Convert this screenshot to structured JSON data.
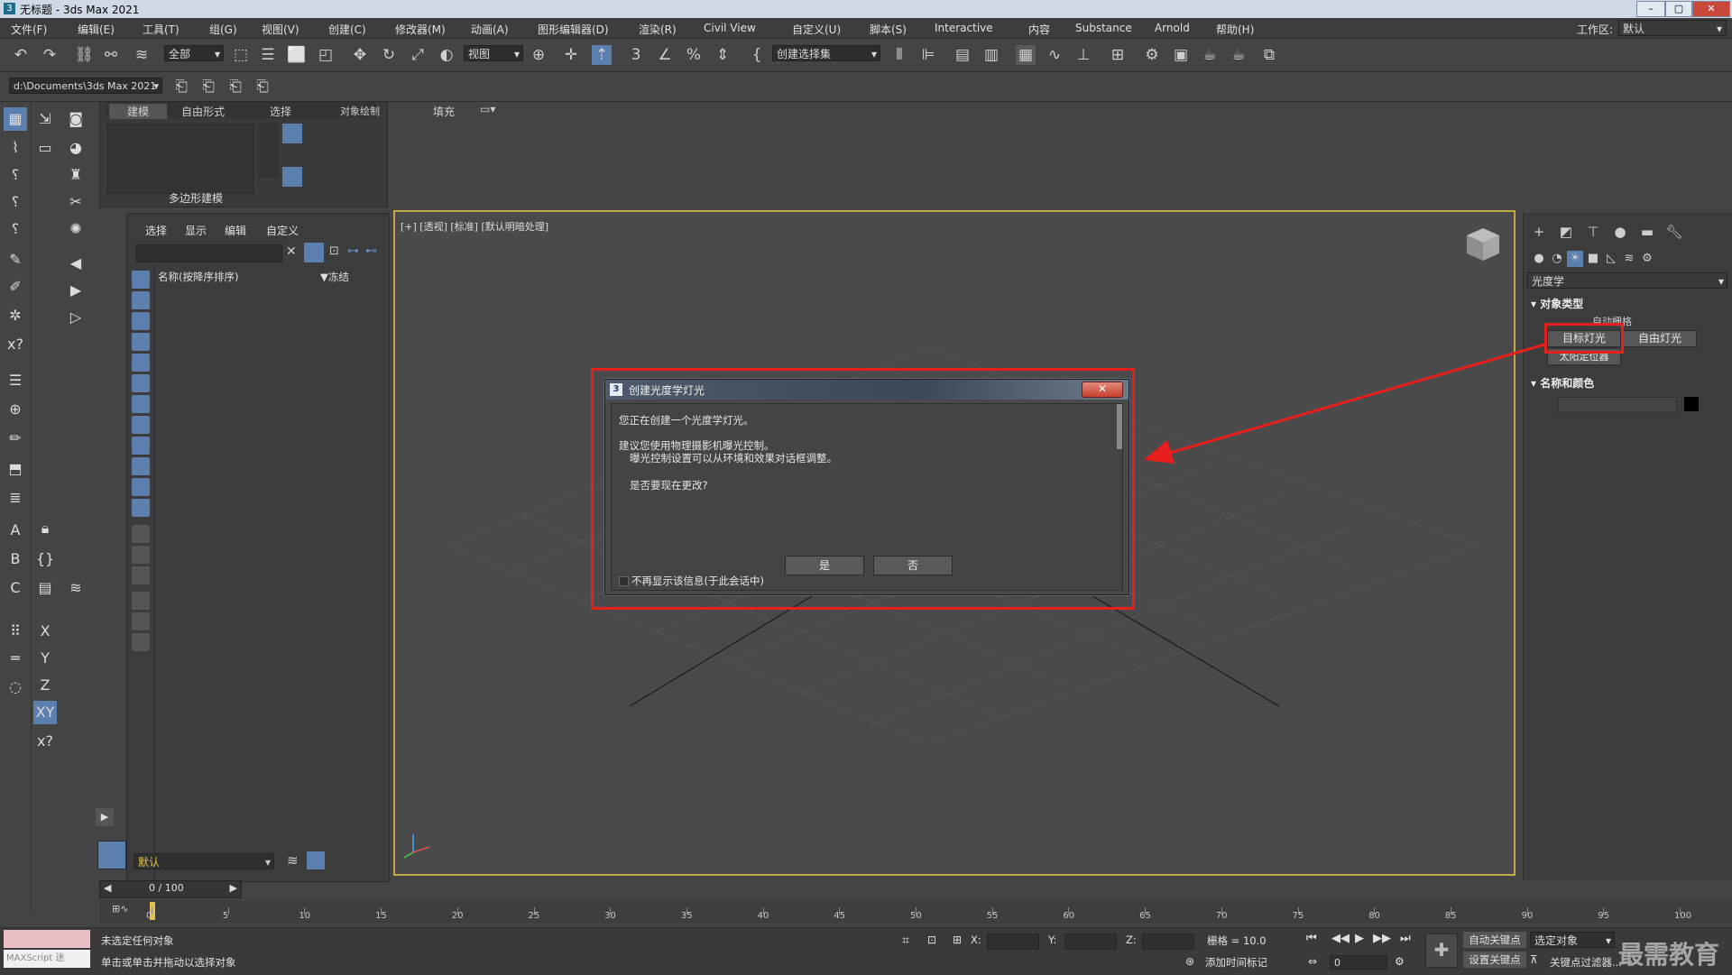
{
  "window": {
    "title": "无标题 - 3ds Max 2021",
    "logo": "3",
    "controls": [
      "–",
      "▢",
      "✕"
    ]
  },
  "menu": [
    "文件(F)",
    "编辑(E)",
    "工具(T)",
    "组(G)",
    "视图(V)",
    "创建(C)",
    "修改器(M)",
    "动画(A)",
    "图形编辑器(D)",
    "渲染(R)",
    "Civil View",
    "自定义(U)",
    "脚本(S)",
    "Interactive",
    "内容",
    "Substance",
    "Arnold",
    "帮助(H)"
  ],
  "workspace": {
    "label": "工作区:",
    "value": "默认"
  },
  "toolbar": {
    "filter_select": "全部",
    "view_select": "视图",
    "selection_set": "创建选择集"
  },
  "project_path": "d:\\Documents\\3ds Max 2021",
  "ribbon": {
    "tabs": [
      "建模",
      "自由形式",
      "选择",
      "对象绘制",
      "填充"
    ],
    "group_label": "多边形建模"
  },
  "explorer": {
    "menu": [
      "选择",
      "显示",
      "编辑",
      "自定义"
    ],
    "col_name": "名称(按降序排序)",
    "col_frozen": "▼冻结",
    "layer_value": "默认",
    "frame_counter": "0 / 100"
  },
  "viewport": {
    "label": "[+] [透视] [标准] [默认明暗处理]"
  },
  "dialog": {
    "title": "创建光度学灯光",
    "line1": "您正在创建一个光度学灯光。",
    "line2": "建议您使用物理摄影机曝光控制。",
    "line3": "曝光控制设置可以从环境和效果对话框调整。",
    "line4": "是否要现在更改?",
    "yes": "是",
    "no": "否",
    "checkbox": "不再显示该信息(于此会话中)",
    "close": "✕"
  },
  "command_panel": {
    "category": "光度学",
    "object_type_header": "对象类型",
    "auto_grid": "自动栅格",
    "target_light": "目标灯光",
    "free_light": "自由灯光",
    "sun_positioner": "太阳定位器",
    "name_color_header": "名称和颜色"
  },
  "timeline": {
    "ticks": [
      0,
      5,
      10,
      15,
      20,
      25,
      30,
      35,
      40,
      45,
      50,
      55,
      60,
      65,
      70,
      75,
      80,
      85,
      90,
      95,
      100
    ]
  },
  "status": {
    "line1": "未选定任何对象",
    "line2": "单击或单击并拖动以选择对象",
    "maxscript": "MAXScript 迷",
    "x_label": "X:",
    "y_label": "Y:",
    "z_label": "Z:",
    "grid": "栅格 = 10.0",
    "add_time_tag": "添加时间标记",
    "auto_key": "自动关键点",
    "set_key": "设置关键点",
    "selected": "选定对象",
    "key_filter": "关键点过滤器...",
    "frame": "0"
  },
  "watermark": "最需教育",
  "colors": {
    "annotation": "#e8201d",
    "viewport_border": "#c7a849"
  }
}
